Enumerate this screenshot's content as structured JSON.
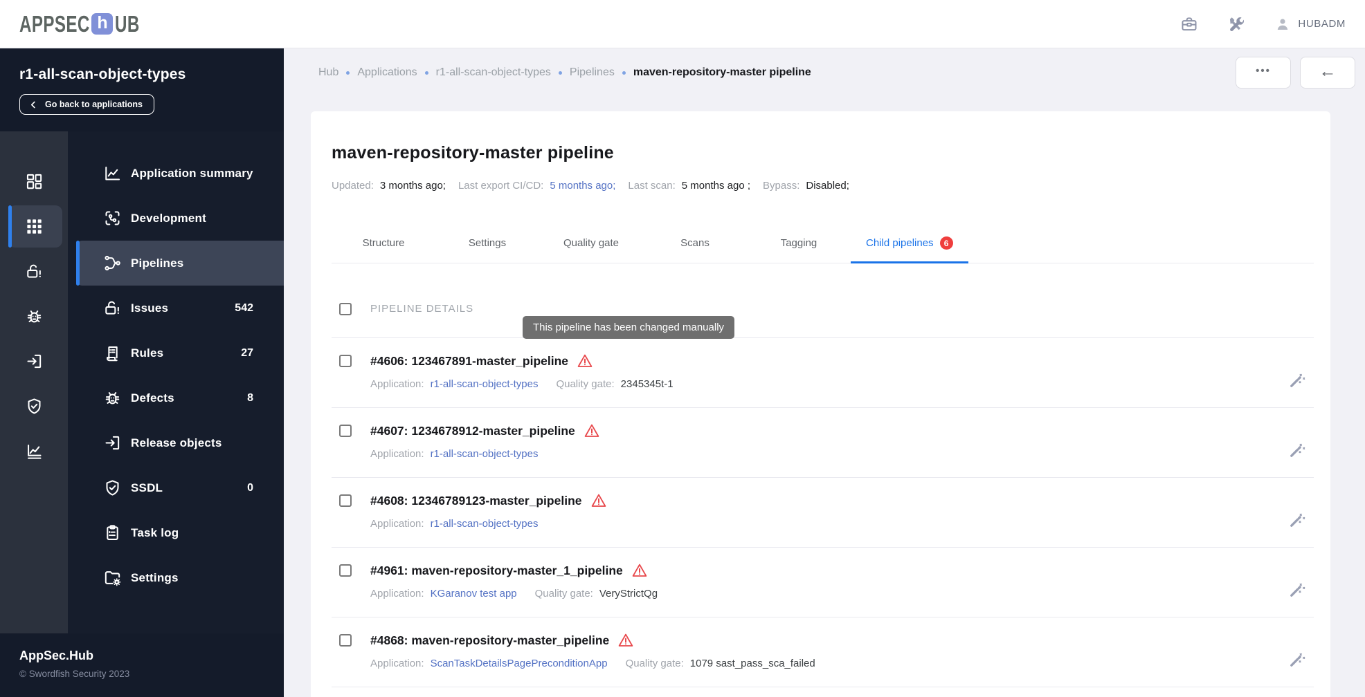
{
  "colors": {
    "sidebar_bg": "#141b2a",
    "rail_bg": "#2b313d",
    "panel_bg": "#161d2c",
    "active_bg": "#3d4557",
    "rail_active_bg": "#3a4150",
    "accent_blue": "#2f80ed",
    "tab_blue": "#1a73e8",
    "link_blue": "#5472c4",
    "badge_red": "#ef3e3d",
    "warning_red": "#e8474b",
    "page_bg": "#f1f1f6",
    "divider": "#e9e9ef",
    "text_dark": "#17181c",
    "text_gray": "#9aa0a6",
    "icon_gray": "#8d93a8",
    "tooltip_bg": "#6f6f6f",
    "logo_gray": "#5d6562",
    "logo_blue": "#8090d8"
  },
  "header": {
    "logo_part1": "APPSEC",
    "logo_square_letter": "h",
    "logo_part2": "UB",
    "user_name": "HUBADM"
  },
  "sidebar": {
    "app_title": "r1-all-scan-object-types",
    "back_button_label": "Go back to applications",
    "rail": [
      {
        "icon": "dashboard",
        "active": false
      },
      {
        "icon": "apps-grid",
        "active": true
      },
      {
        "icon": "unlock-alert",
        "active": false
      },
      {
        "icon": "bug",
        "active": false
      },
      {
        "icon": "exit",
        "active": false
      },
      {
        "icon": "shield-check",
        "active": false
      },
      {
        "icon": "chart",
        "active": false
      }
    ],
    "menu": [
      {
        "icon": "line-chart",
        "label": "Application summary"
      },
      {
        "icon": "dev-frame",
        "label": "Development"
      },
      {
        "icon": "branch",
        "label": "Pipelines",
        "active": true
      },
      {
        "icon": "unlock-alert",
        "label": "Issues",
        "count": "542"
      },
      {
        "icon": "scroll",
        "label": "Rules",
        "count": "27"
      },
      {
        "icon": "bug",
        "label": "Defects",
        "count": "8"
      },
      {
        "icon": "exit",
        "label": "Release objects"
      },
      {
        "icon": "shield-check",
        "label": "SSDL",
        "count": "0"
      },
      {
        "icon": "clipboard",
        "label": "Task log"
      },
      {
        "icon": "folder-gear",
        "label": "Settings"
      }
    ],
    "footer_title": "AppSec.Hub",
    "footer_copyright": "© Swordfish Security 2023"
  },
  "breadcrumb": {
    "items": [
      "Hub",
      "Applications",
      "r1-all-scan-object-types",
      "Pipelines"
    ],
    "current": "maven-repository-master pipeline"
  },
  "toolbar": {
    "more_label": "•••",
    "back_label": "←"
  },
  "page": {
    "title": "maven-repository-master pipeline",
    "meta": [
      {
        "label": "Updated:",
        "value": "3 months ago;",
        "link": false
      },
      {
        "label": "Last export CI/CD:",
        "value": "5 months ago;",
        "link": true
      },
      {
        "label": "Last scan:",
        "value": "5 months ago ;",
        "link": false
      },
      {
        "label": "Bypass:",
        "value": "Disabled;",
        "link": false
      }
    ],
    "tabs": [
      {
        "label": "Structure"
      },
      {
        "label": "Settings"
      },
      {
        "label": "Quality gate"
      },
      {
        "label": "Scans"
      },
      {
        "label": "Tagging"
      },
      {
        "label": "Child pipelines",
        "badge": "6",
        "active": true
      }
    ],
    "table": {
      "header": "PIPELINE DETAILS",
      "tooltip": "This pipeline has been changed manually",
      "labels": {
        "application": "Application:",
        "quality_gate": "Quality gate:"
      },
      "rows": [
        {
          "title": "#4606: 123467891-master_pipeline",
          "application": "r1-all-scan-object-types",
          "quality_gate": "2345345t-1"
        },
        {
          "title": "#4607: 1234678912-master_pipeline",
          "application": "r1-all-scan-object-types",
          "quality_gate": ""
        },
        {
          "title": "#4608: 12346789123-master_pipeline",
          "application": "r1-all-scan-object-types",
          "quality_gate": ""
        },
        {
          "title": "#4961: maven-repository-master_1_pipeline",
          "application": "KGaranov test app",
          "quality_gate": "VeryStrictQg"
        },
        {
          "title": "#4868: maven-repository-master_pipeline",
          "application": "ScanTaskDetailsPagePreconditionApp",
          "quality_gate": "1079 sast_pass_sca_failed"
        }
      ]
    }
  }
}
